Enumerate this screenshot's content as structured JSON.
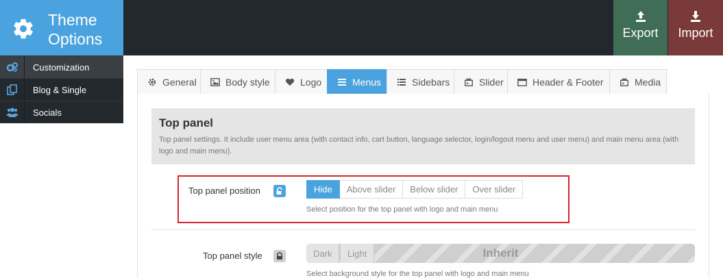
{
  "header": {
    "title_line1": "Theme",
    "title_line2": "Options",
    "export_label": "Export",
    "import_label": "Import",
    "export_color": "#3f6d55",
    "import_color": "#7a3a39",
    "brand_color": "#4aa3df"
  },
  "sidebar": {
    "items": [
      {
        "label": "Customization",
        "icon": "cogs-icon",
        "active": true
      },
      {
        "label": "Blog & Single",
        "icon": "copy-icon",
        "active": false
      },
      {
        "label": "Socials",
        "icon": "users-icon",
        "active": false
      }
    ]
  },
  "tabs": [
    {
      "label": "General",
      "icon": "gear-icon"
    },
    {
      "label": "Body style",
      "icon": "image-icon"
    },
    {
      "label": "Logo",
      "icon": "heart-icon"
    },
    {
      "label": "Menus",
      "icon": "menu-icon",
      "active": true
    },
    {
      "label": "Sidebars",
      "icon": "list-icon"
    },
    {
      "label": "Slider",
      "icon": "slider-icon"
    },
    {
      "label": "Header & Footer",
      "icon": "window-icon"
    },
    {
      "label": "Media",
      "icon": "media-icon"
    }
  ],
  "section": {
    "title": "Top panel",
    "description": "Top panel settings. It include user menu area (with contact info, cart button, language selector, login/logout menu and user menu) and main menu area (with logo and main menu)."
  },
  "fields": {
    "position": {
      "label": "Top panel position",
      "options": [
        "Hide",
        "Above slider",
        "Below slider",
        "Over slider"
      ],
      "selected": "Hide",
      "help": "Select position for the top panel with logo and main menu",
      "lock": "unlocked"
    },
    "style": {
      "label": "Top panel style",
      "options": [
        "Dark",
        "Light"
      ],
      "inherit_label": "Inherit",
      "help": "Select background style for the top panel with logo and main menu",
      "lock": "locked"
    }
  }
}
